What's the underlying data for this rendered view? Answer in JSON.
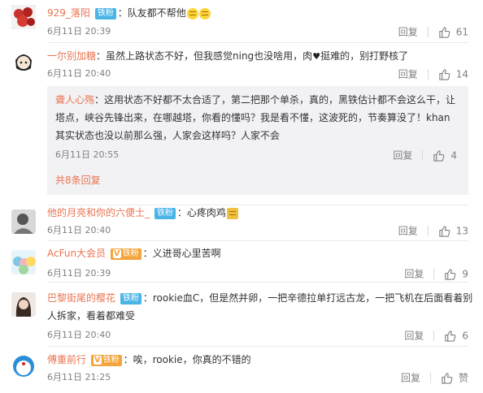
{
  "actions": {
    "reply_label": "回复"
  },
  "comments": [
    {
      "author": "929_落阳",
      "badge": "铁粉",
      "text": "：队友都不帮他",
      "time": "6月11日 20:39",
      "likes": "61"
    },
    {
      "author": "一尔别加糖",
      "text": "：虽然上路状态不好，但我感觉ning也没啥用，肉",
      "text_tail": "挺难的，别打野核了",
      "time": "6月11日 20:40",
      "likes": "14",
      "reply": {
        "author": "聋人心殇",
        "text": "：这用状态不好都不太合适了，第二把那个单杀，真的，黑铁估计都不会这么干，让塔点，峡谷先锋出来，在哪越塔，你看的懂吗？我是看不懂，这波死的，节奏算没了！khan其实状态也没以前那么强，人家会这样吗？人家不会",
        "time": "6月11日 20:55",
        "likes": "4"
      },
      "more_replies": "共8条回复"
    },
    {
      "author": "他的月亮和你的六便士_",
      "badge": "铁粉",
      "text": "：心疼肉鸡",
      "time": "6月11日 20:40",
      "likes": "13"
    },
    {
      "author": "AcFun大会员",
      "badge": "铁粉",
      "badge_vip": "V",
      "text": "：义进哥心里苦啊",
      "time": "6月11日 20:39",
      "likes": "9"
    },
    {
      "author": "巴黎街尾的樱花",
      "badge": "铁粉",
      "text": "：rookie血C，但是然并卵，一把辛德拉单打远古龙，一把飞机在后面看着别",
      "text_line2": "人拆家，看着都难受",
      "time": "6月11日 20:40",
      "likes": "6"
    },
    {
      "author": "傅重前行",
      "badge": "铁粉",
      "badge_vip": "V",
      "text": "：唉，rookie，你真的不错的",
      "time": "6月11日 21:25",
      "likes": "赞"
    }
  ],
  "colors": {
    "author": "#eb7350",
    "badge": "#4bb4e6",
    "badge_vip": "#f3a43c",
    "meta": "#808080",
    "reply_bg": "#f2f2f5"
  }
}
